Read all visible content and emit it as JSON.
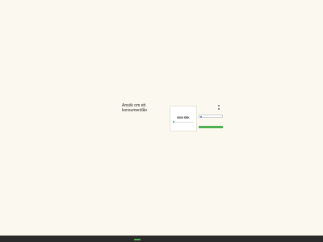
{
  "hero": {
    "title": "Ansök om ett konsumentlån"
  },
  "calculator": {
    "label": "",
    "amount": "5000 SEK",
    "slider_fraction": 0.03,
    "accent_color": "#4caf50"
  },
  "form": {
    "label": "",
    "checkbox_1_text": "",
    "checkbox_2_text": "",
    "input_placeholder": "",
    "consent_text": "",
    "submit_label": ""
  },
  "cookie_bar": {
    "text": "",
    "accept_label": "",
    "link_1": "",
    "link_2": ""
  }
}
